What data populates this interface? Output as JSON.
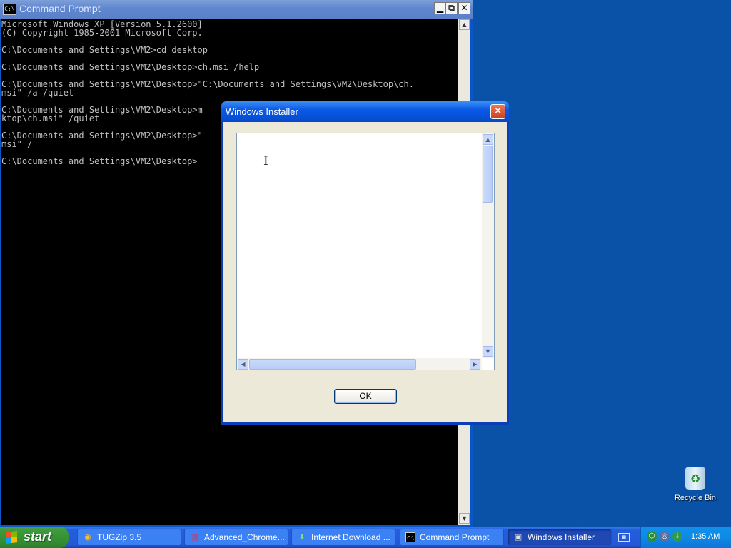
{
  "cmd_window": {
    "title": "Command Prompt",
    "app_icon": "C:\\",
    "minimize": "▁",
    "restore": "⧉",
    "close": "✕",
    "lines": [
      "Microsoft Windows XP [Version 5.1.2600]",
      "(C) Copyright 1985-2001 Microsoft Corp.",
      "",
      "C:\\Documents and Settings\\VM2>cd desktop",
      "",
      "C:\\Documents and Settings\\VM2\\Desktop>ch.msi /help",
      "",
      "C:\\Documents and Settings\\VM2\\Desktop>\"C:\\Documents and Settings\\VM2\\Desktop\\ch.",
      "msi\" /a /quiet",
      "",
      "C:\\Documents and Settings\\VM2\\Desktop>m",
      "ktop\\ch.msi\" /quiet",
      "",
      "C:\\Documents and Settings\\VM2\\Desktop>\"",
      "msi\" /",
      "",
      "C:\\Documents and Settings\\VM2\\Desktop>"
    ]
  },
  "dialog": {
    "title": "Windows Installer",
    "close": "✕",
    "textbox_value": "",
    "ok_label": "OK"
  },
  "desktop": {
    "recycle_bin_label": "Recycle Bin"
  },
  "taskbar": {
    "start_label": "start",
    "items": [
      {
        "label": "TUGZip 3.5",
        "icon": "archive-icon",
        "active": false
      },
      {
        "label": "Advanced_Chrome...",
        "icon": "winrar-icon",
        "active": false
      },
      {
        "label": "Internet Download ...",
        "icon": "idm-icon",
        "active": false
      },
      {
        "label": "Command Prompt",
        "icon": "cmd-icon",
        "active": false
      },
      {
        "label": "Windows Installer",
        "icon": "installer-icon",
        "active": true
      }
    ],
    "clock": "1:35 AM"
  },
  "colors": {
    "desktop": "#0a52a8",
    "taskbar": "#245edb",
    "start_green": "#3c9a3c",
    "tray": "#0e8ae5"
  }
}
